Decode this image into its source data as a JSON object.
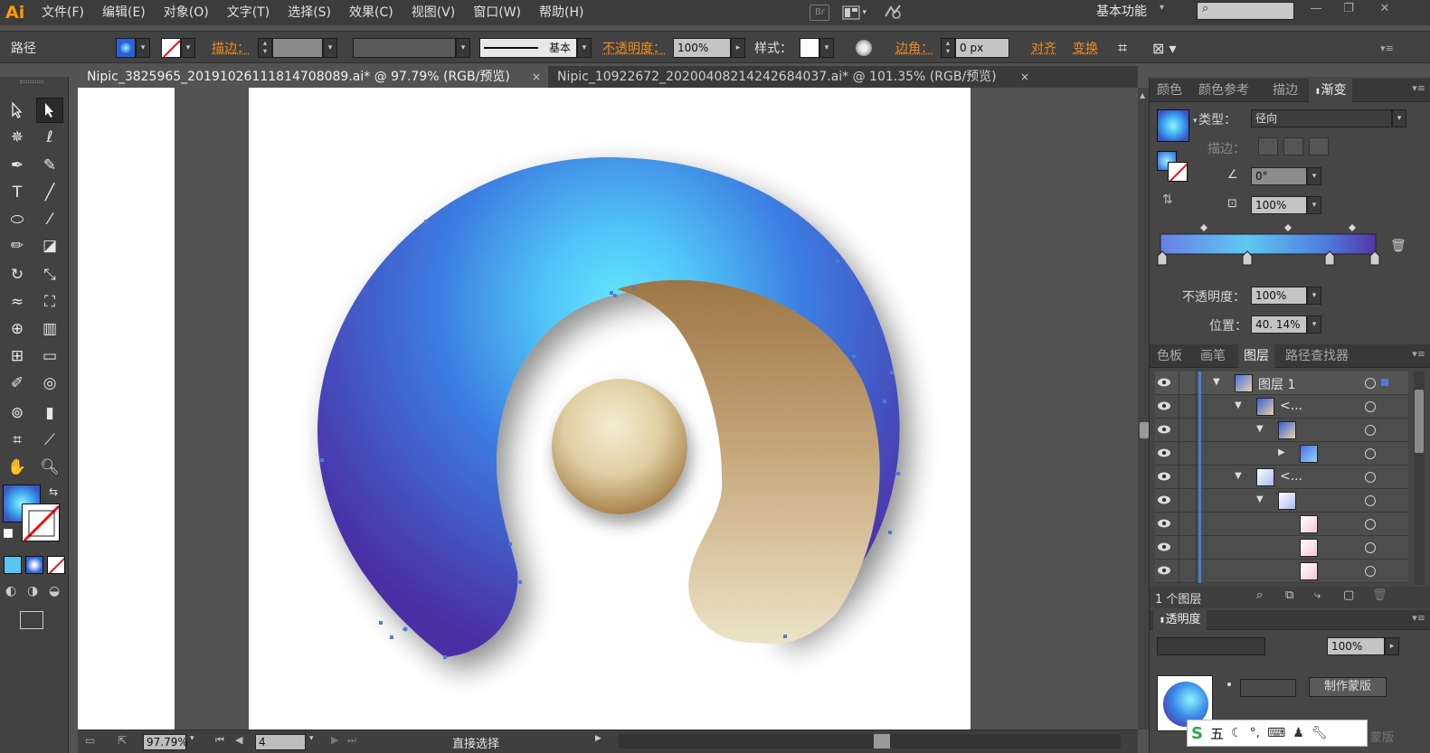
{
  "app": {
    "logo": "Ai"
  },
  "menu": [
    "文件(F)",
    "编辑(E)",
    "对象(O)",
    "文字(T)",
    "选择(S)",
    "效果(C)",
    "视图(V)",
    "窗口(W)",
    "帮助(H)"
  ],
  "menu_icons": {
    "bridge_label": "Br"
  },
  "workspace": {
    "label": "基本功能"
  },
  "control": {
    "object_type": "路径",
    "stroke_label": "描边：",
    "stroke_profile": "基本",
    "opacity_label": "不透明度：",
    "opacity_value": "100%",
    "style_label": "样式：",
    "corner_label": "边角：",
    "corner_value": "0 px",
    "align_label": "对齐",
    "transform_label": "变换"
  },
  "tabs": [
    {
      "label": "Nipic_3825965_20191026111814708089.ai* @ 97.79% (RGB/预览)",
      "active": true
    },
    {
      "label": "Nipic_10922672_20200408214242684037.ai* @ 101.35% (RGB/预览)",
      "active": false
    }
  ],
  "tab_close": "×",
  "status": {
    "zoom": "97.79%",
    "artboard_number": "4",
    "current_tool": "直接选择"
  },
  "panel_gradient": {
    "tabs": [
      "颜色",
      "颜色参考",
      "描边",
      "渐变"
    ],
    "active_tab": "渐变",
    "type_label": "类型：",
    "type_value": "径向",
    "stroke_label": "描边：",
    "angle_value": "0°",
    "aspect_value": "100%",
    "opacity_label": "不透明度：",
    "opacity_value": "100%",
    "location_label": "位置：",
    "location_value": "40. 14%",
    "gradient_colors": [
      "#6a7ee6",
      "#5ec8f2",
      "#4f78dc",
      "#5236a8"
    ]
  },
  "panel_layers": {
    "tabs": [
      "色板",
      "画笔",
      "图层",
      "路径查找器"
    ],
    "active_tab": "图层",
    "layer_name": "图层 1",
    "group_label": "<...",
    "footer": "1 个图层"
  },
  "panel_transparency": {
    "title": "透明度",
    "opacity_value": "100%",
    "mask_button": "制作蒙版",
    "release_label": "蒙版"
  },
  "ime": {
    "label": "五"
  },
  "colors": {
    "blue_light": "#64e6ff",
    "blue_mid": "#3f86e6",
    "blue_dark": "#4a2fa6",
    "gold_dark": "#a27d4f",
    "gold_light": "#e9e0c2",
    "ball_light": "#f3ead0",
    "ball_dark": "#a8834e"
  }
}
